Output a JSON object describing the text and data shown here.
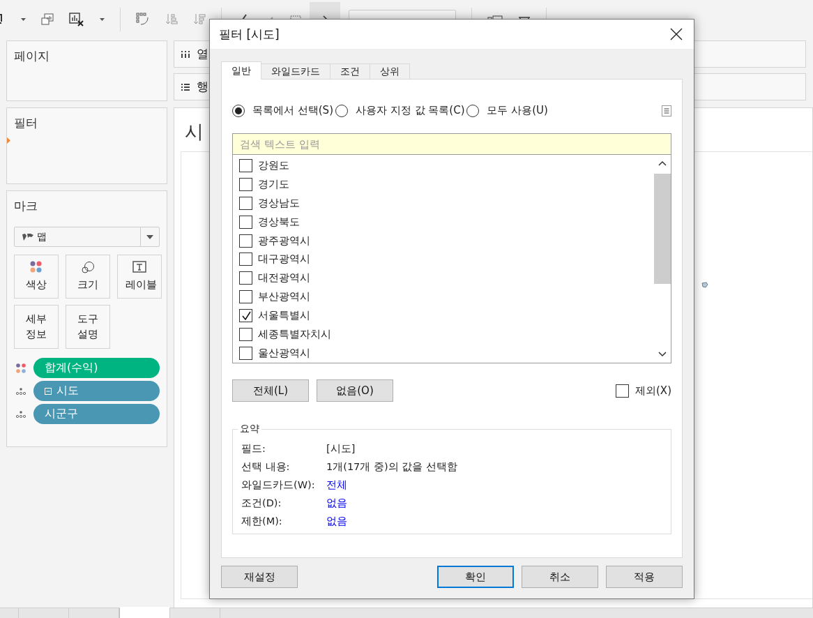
{
  "left_panel": {
    "pages": {
      "title": "페이지"
    },
    "filters": {
      "title": "필터"
    },
    "marks": {
      "title": "마크",
      "mark_type": "맵",
      "cards": [
        {
          "label": "색상",
          "kind": "color"
        },
        {
          "label": "크기",
          "kind": "size"
        },
        {
          "label": "레이블",
          "kind": "label"
        },
        {
          "label": "세부 정보",
          "kind": "detail"
        },
        {
          "label": "도구 설명",
          "kind": "tooltip"
        }
      ],
      "pills": [
        {
          "label": "합계(수익)",
          "kind": "color",
          "color": "#00b482",
          "collapse_box": false
        },
        {
          "label": "시도",
          "kind": "detail",
          "color": "#4a97b4",
          "collapse_box": true
        },
        {
          "label": "시군구",
          "kind": "detail",
          "color": "#4a97b4",
          "collapse_box": false
        }
      ]
    }
  },
  "shelves": [
    {
      "label": "열",
      "kind": "columns"
    },
    {
      "label": "행",
      "kind": "rows"
    }
  ],
  "sheet": {
    "title": "시"
  },
  "status_tabs": [
    {
      "selected": false
    },
    {
      "selected": false
    },
    {
      "selected": false
    },
    {
      "selected": true
    },
    {
      "selected": false
    }
  ],
  "dialog": {
    "title": "필터 [시도]",
    "tabs": [
      {
        "label": "일반",
        "selected": true
      },
      {
        "label": "와일드카드",
        "selected": false
      },
      {
        "label": "조건",
        "selected": false
      },
      {
        "label": "상위",
        "selected": false
      }
    ],
    "modes": [
      {
        "label": "목록에서 선택(S)",
        "selected": true
      },
      {
        "label": "사용자 지정 값 목록(C)",
        "selected": false
      },
      {
        "label": "모두 사용(U)",
        "selected": false
      }
    ],
    "search": {
      "placeholder": "검색 텍스트 입력"
    },
    "items": [
      {
        "label": "강원도",
        "checked": false
      },
      {
        "label": "경기도",
        "checked": false
      },
      {
        "label": "경상남도",
        "checked": false
      },
      {
        "label": "경상북도",
        "checked": false
      },
      {
        "label": "광주광역시",
        "checked": false
      },
      {
        "label": "대구광역시",
        "checked": false
      },
      {
        "label": "대전광역시",
        "checked": false
      },
      {
        "label": "부산광역시",
        "checked": false
      },
      {
        "label": "서울특별시",
        "checked": true
      },
      {
        "label": "세종특별자치시",
        "checked": false
      },
      {
        "label": "울산광역시",
        "checked": false
      }
    ],
    "list_buttons": [
      "전체(L)",
      "없음(O)"
    ],
    "exclude": {
      "label": "제외(X)",
      "checked": false
    },
    "summary": {
      "title": "요약",
      "rows": [
        {
          "label": "필드:",
          "value": "[시도]",
          "kind": "text"
        },
        {
          "label": "선택 내용:",
          "value": "1개(17개 중)의 값을 선택함",
          "kind": "text"
        },
        {
          "label": "와일드카드(W):",
          "value": "전체",
          "kind": "link"
        },
        {
          "label": "조건(D):",
          "value": "없음",
          "kind": "link"
        },
        {
          "label": "제한(M):",
          "value": "없음",
          "kind": "link"
        }
      ]
    },
    "reset_button": "재설정",
    "buttons": [
      {
        "label": "확인",
        "default": true
      },
      {
        "label": "취소",
        "default": false
      },
      {
        "label": "적용",
        "default": false
      }
    ]
  }
}
